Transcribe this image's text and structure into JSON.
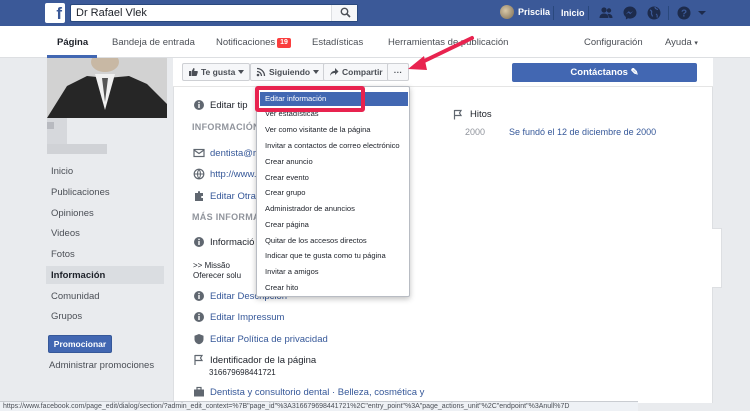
{
  "topbar": {
    "logo": "f",
    "search_value": "Dr Rafael Vlek",
    "user_name": "Priscila",
    "home_label": "Inicio",
    "brand_color": "#3b5998"
  },
  "pagenav": {
    "tabs": [
      {
        "label": "Página",
        "active": true
      },
      {
        "label": "Bandeja de entrada"
      },
      {
        "label": "Notificaciones"
      },
      {
        "label": "Estadísticas"
      },
      {
        "label": "Herramientas de publicación"
      }
    ],
    "notifications_badge": "19",
    "settings_label": "Configuración",
    "help_label": "Ayuda"
  },
  "sidebar": {
    "items": [
      {
        "label": "Inicio"
      },
      {
        "label": "Publicaciones"
      },
      {
        "label": "Opiniones"
      },
      {
        "label": "Videos"
      },
      {
        "label": "Fotos"
      },
      {
        "label": "Información",
        "active": true
      },
      {
        "label": "Comunidad"
      },
      {
        "label": "Grupos"
      }
    ],
    "promote_label": "Promocionar",
    "admin_promos_label": "Administrar promociones"
  },
  "actions": {
    "like_label": "Te gusta",
    "following_label": "Siguiendo",
    "share_label": "Compartir",
    "more_label": "···",
    "contact_label": "Contáctanos"
  },
  "info": {
    "edit_type_label": "Editar tip",
    "section_info_title": "INFORMACIÓN",
    "email_partial": "dentista@ra",
    "website_partial": "http://www.r",
    "edit_others_partial": "Editar Otras",
    "section_more_title": "MÁS INFORMA",
    "info_partial": "Informació",
    "mission_line1": ">> Missão",
    "mission_line2": "Oferecer solu",
    "edit_description": "Editar Descripción",
    "edit_impressum": "Editar Impressum",
    "edit_privacy": "Editar Política de privacidad",
    "page_id_label": "Identificador de la página",
    "page_id_value": "316679698441721",
    "category_text": "Dentista y consultorio dental · Belleza, cosmética y"
  },
  "milestones": {
    "title": "Hitos",
    "year": "2000",
    "text": "Se fundó el 12 de diciembre de 2000"
  },
  "dropdown": {
    "items": [
      {
        "label": "Editar información",
        "highlighted": true
      },
      {
        "label": "Ver estadísticas"
      },
      {
        "label": "Ver como visitante de la página"
      },
      {
        "label": "Invitar a contactos de correo electrónico"
      },
      {
        "label": "Crear anuncio"
      },
      {
        "label": "Crear evento"
      },
      {
        "label": "Crear grupo"
      },
      {
        "label": "Administrador de anuncios"
      },
      {
        "label": "Crear página"
      },
      {
        "label": "Quitar de los accesos directos"
      },
      {
        "label": "Indicar que te gusta como tu página"
      },
      {
        "label": "Invitar a amigos"
      },
      {
        "label": "Crear hito"
      }
    ],
    "highlight_color": "#4267b2",
    "annotation_color": "#e8234f"
  },
  "statusbar": {
    "url": "https://www.facebook.com/page_edit/dialog/section/?admin_edit_context=%7B\"page_id\"%3A316679698441721%2C\"entry_point\"%3A\"page_actions_unit\"%2C\"endpoint\"%3Anull%7D"
  }
}
